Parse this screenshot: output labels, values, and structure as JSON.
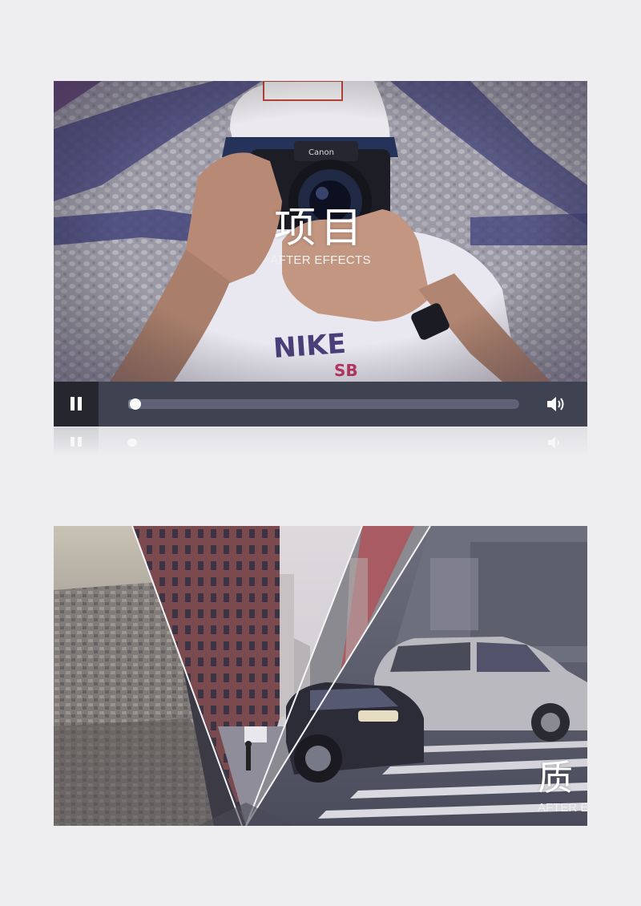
{
  "player": {
    "title": "项目",
    "subtitle": "AFTER EFFECTS",
    "play_state_icon": "pause-icon",
    "volume_icon": "speaker-icon",
    "progress": 0.0,
    "colors": {
      "controls_bg": "#3e4251",
      "button_bg": "#25262e",
      "track": "#5d6275",
      "knob": "#ffffff"
    }
  },
  "collage": {
    "glyph": "质",
    "subtitle": "AFTER E"
  }
}
